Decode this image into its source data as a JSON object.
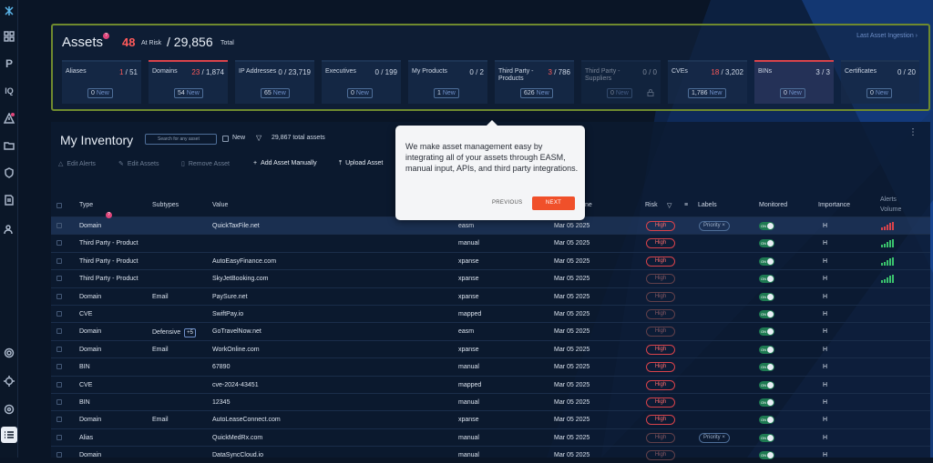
{
  "sidebar": {
    "items": [
      "logo-icon",
      "grid-icon",
      "p-icon",
      "iq-icon",
      "alert-icon",
      "folder-icon",
      "shield-icon",
      "document-icon",
      "users-icon",
      "settings-icon",
      "crosshair-icon",
      "support-icon",
      "list-icon"
    ],
    "iq_label": "IQ",
    "p_label": "P"
  },
  "assets_summary": {
    "title": "Assets",
    "help": "?",
    "at_risk_count": "48",
    "at_risk_label": "At Risk",
    "total": "/ 29,856",
    "total_label": "Total",
    "last_ingestion": "Last Asset Ingestion ›"
  },
  "asset_cards": [
    {
      "name": "Aliases",
      "risk": "1",
      "total": "/ 51",
      "new": "0",
      "new_label": "New"
    },
    {
      "name": "Domains",
      "risk": "23",
      "total": "/ 1,874",
      "new": "54",
      "new_label": "New"
    },
    {
      "name": "IP Addresses",
      "risk": "0",
      "total": "/ 23,719",
      "new": "65",
      "new_label": "New"
    },
    {
      "name": "Executives",
      "risk": "",
      "total": "0 / 199",
      "new": "0",
      "new_label": "New"
    },
    {
      "name": "My Products",
      "risk": "",
      "total": "0 / 2",
      "new": "1",
      "new_label": "New"
    },
    {
      "name": "Third Party - Products",
      "risk": "3",
      "total": "/ 786",
      "new": "626",
      "new_label": "New"
    },
    {
      "name": "Third Party - Suppliers",
      "risk": "",
      "total": "0 / 0",
      "new": "0",
      "new_label": "New"
    },
    {
      "name": "CVEs",
      "risk": "18",
      "total": "/ 3,202",
      "new": "1,786",
      "new_label": "New"
    },
    {
      "name": "BINs",
      "risk": "",
      "total": "3 / 3",
      "new": "0",
      "new_label": "New"
    },
    {
      "name": "Certificates",
      "risk": "",
      "total": "0 / 20",
      "new": "0",
      "new_label": "New"
    }
  ],
  "inventory": {
    "title": "My Inventory",
    "search_placeholder": "Search for any asset",
    "new_label": "New",
    "total_assets": "29,867 total assets",
    "toolbar": {
      "edit_alerts": "Edit Alerts",
      "edit_assets": "Edit Assets",
      "remove_asset": "Remove Asset",
      "add_manually": "Add Asset Manually",
      "upload_asset": "Upload Asset"
    },
    "columns": {
      "type": "Type",
      "subtypes": "Subtypes",
      "value": "Value",
      "date": "ne",
      "risk": "Risk",
      "labels": "Labels",
      "monitored": "Monitored",
      "importance": "Importance",
      "alerts_volume": "Alerts Volume"
    },
    "rows": [
      {
        "type": "Domain",
        "subtype": "",
        "value": "QuickTaxFile.net",
        "source": "easm",
        "date": "Mar 05 2025",
        "risk": "High",
        "label": "Priority ×",
        "imp": "H",
        "bars": "red"
      },
      {
        "type": "Third Party - Product",
        "subtype": "",
        "value": "",
        "source": "manual",
        "date": "Mar 05 2025",
        "risk": "High",
        "label": "",
        "imp": "H",
        "bars": "green"
      },
      {
        "type": "Third Party - Product",
        "subtype": "",
        "value": "AutoEasyFinance.com",
        "source": "xpanse",
        "date": "Mar 05 2025",
        "risk": "High",
        "label": "",
        "imp": "H",
        "bars": "green"
      },
      {
        "type": "Third Party - Product",
        "subtype": "",
        "value": "SkyJetBooking.com",
        "source": "xpanse",
        "date": "Mar 05 2025",
        "risk": "High",
        "label": "",
        "imp": "H",
        "bars": "green"
      },
      {
        "type": "Domain",
        "subtype": "Email",
        "value": "PaySure.net",
        "source": "xpanse",
        "date": "Mar 05 2025",
        "risk": "High",
        "label": "",
        "imp": "H",
        "bars": ""
      },
      {
        "type": "CVE",
        "subtype": "",
        "value": "SwiftPay.io",
        "source": "mapped",
        "date": "Mar 05 2025",
        "risk": "High",
        "label": "",
        "imp": "H",
        "bars": ""
      },
      {
        "type": "Domain",
        "subtype": "Defensive",
        "subtype_extra": "+5",
        "value": "GoTravelNow.net",
        "source": "easm",
        "date": "Mar 05 2025",
        "risk": "High",
        "label": "",
        "imp": "H",
        "bars": ""
      },
      {
        "type": "Domain",
        "subtype": "Email",
        "value": "WorkOnline.com",
        "source": "xpanse",
        "date": "Mar 05 2025",
        "risk": "High",
        "label": "",
        "imp": "H",
        "bars": ""
      },
      {
        "type": "BIN",
        "subtype": "",
        "value": "67890",
        "source": "manual",
        "date": "Mar 05 2025",
        "risk": "High",
        "label": "",
        "imp": "H",
        "bars": ""
      },
      {
        "type": "CVE",
        "subtype": "",
        "value": "cve-2024-43451",
        "source": "mapped",
        "date": "Mar 05 2025",
        "risk": "High",
        "label": "",
        "imp": "H",
        "bars": ""
      },
      {
        "type": "BIN",
        "subtype": "",
        "value": "12345",
        "source": "manual",
        "date": "Mar 05 2025",
        "risk": "High",
        "label": "",
        "imp": "H",
        "bars": ""
      },
      {
        "type": "Domain",
        "subtype": "Email",
        "value": "AutoLeaseConnect.com",
        "source": "xpanse",
        "date": "Mar 05 2025",
        "risk": "High",
        "label": "",
        "imp": "H",
        "bars": ""
      },
      {
        "type": "Alias",
        "subtype": "",
        "value": "QuickMedRx.com",
        "source": "manual",
        "date": "Mar 05 2025",
        "risk": "High",
        "label": "Priority ×",
        "imp": "H",
        "bars": ""
      },
      {
        "type": "Domain",
        "subtype": "",
        "value": "DataSyncCloud.io",
        "source": "manual",
        "date": "Mar 05 2025",
        "risk": "High",
        "label": "",
        "imp": "H",
        "bars": ""
      }
    ]
  },
  "tooltip": {
    "text": "We make asset management easy by integrating all of your assets through EASM, manual input, APIs, and third party integrations.",
    "previous": "PREVIOUS",
    "next": "NEXT"
  },
  "colors": {
    "accent": "#f0502a",
    "risk": "#d9434b",
    "monitored": "#1e7a52",
    "highlight_border": "#6f8a2e"
  }
}
